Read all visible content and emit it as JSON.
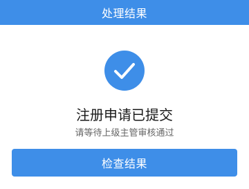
{
  "header": {
    "title": "处理结果"
  },
  "status": {
    "icon": "check-icon",
    "title": "注册申请已提交",
    "subtitle": "请等待上级主管审核通过"
  },
  "action": {
    "label": "检查结果"
  },
  "colors": {
    "primary": "#3e8ee8"
  }
}
